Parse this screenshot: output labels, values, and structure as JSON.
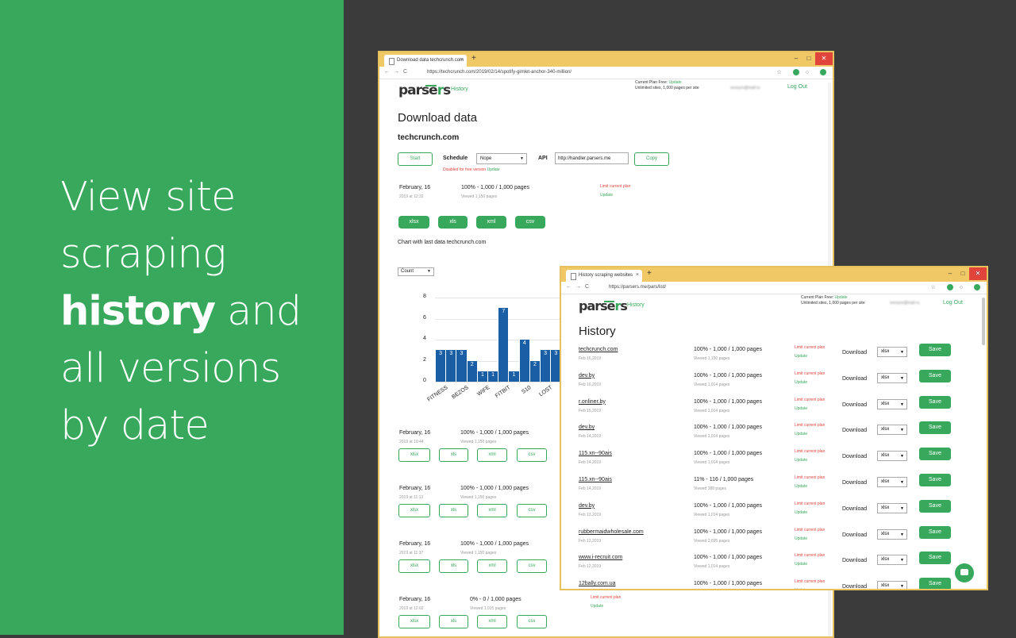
{
  "promo": {
    "line1": "View site",
    "line2": "scraping",
    "line3_bold": "history",
    "line3_rest": " and",
    "line4": "all versions",
    "line5": "by date"
  },
  "win1": {
    "tab_title": "Download data techcrunch.com",
    "url": "https://techcrunch.com/2019/02/14/spotify-gimlet-anchor-340-million/",
    "nav_history": "History",
    "plan_line1": "Current Plan Free: ",
    "plan_update": "Update",
    "plan_line2": "Unlimited sites, 1,000 pages per site",
    "email": "xxxxyzx@mail.ru",
    "logout": "Log Out",
    "title": "Download data",
    "site": "techcrunch.com",
    "start_label": "Start",
    "schedule_label": "Schedule",
    "schedule_value": "Nope",
    "disabled_note": "Disabled for free version",
    "disabled_update": "Update",
    "api_label": "API",
    "api_value": "http://handler.parsers.me",
    "copy_label": "Copy",
    "limit_text": "Limit current plan",
    "update_text": "Update",
    "chart_caption": "Chart with last data techcrunch.com",
    "count_select": "Count",
    "runs": [
      {
        "date": "February, 16",
        "time": "2019 at 12:32",
        "pages": "100% - 1,000 / 1,000 pages",
        "viewed": "Viewed 1,150 pages"
      },
      {
        "date": "February, 16",
        "time": "2019 at 10:44",
        "pages": "100% - 1,000 / 1,000 pages",
        "viewed": "Viewed 1,150 pages"
      },
      {
        "date": "February, 16",
        "time": "2019 at 11:13",
        "pages": "100% - 1,000 / 1,000 pages",
        "viewed": "Viewed 1,150 pages"
      },
      {
        "date": "February, 16",
        "time": "2019 at 11:37",
        "pages": "100% - 1,000 / 1,000 pages",
        "viewed": "Viewed 1,150 pages"
      },
      {
        "date": "February, 16",
        "time": "2019 at 12:02",
        "pages": "0% - 0 / 1,000 pages",
        "viewed": "Viewed 1,015 pages"
      }
    ],
    "formats": [
      "xlsx",
      "xls",
      "xml",
      "csv"
    ]
  },
  "chart_data": {
    "type": "bar",
    "categories": [
      "FITNESS",
      "",
      "BEZOS",
      "",
      "WIFE",
      "",
      "FITBIT",
      "",
      "S10",
      "",
      "LOST",
      ""
    ],
    "values": [
      3,
      3,
      3,
      2,
      1,
      1,
      7,
      1,
      4,
      2,
      3,
      3
    ],
    "ylim": [
      0,
      8
    ],
    "yticks": [
      0,
      2,
      4,
      6,
      8
    ],
    "grid": true
  },
  "win2": {
    "tab_title": "History scraping websites",
    "url": "https://parsers.me/pars/list/",
    "nav_history": "History",
    "plan_line1": "Current Plan Free: ",
    "plan_update": "Update",
    "plan_line2": "Unlimited sites, 1,000 pages per site",
    "email": "xxxxyzx@mail.ru",
    "logout": "Log Out",
    "title": "History",
    "limit_text": "Limit current plan",
    "update_text": "Update",
    "download_label": "Download",
    "format_value": "xlsx",
    "save_label": "Save",
    "rows": [
      {
        "site": "techcrunch.com",
        "date": "Feb 16,2019",
        "pages": "100% - 1,000 / 1,000 pages",
        "viewed": "Viewed 1,150 pages"
      },
      {
        "site": "dev.by",
        "date": "Feb 16,2019",
        "pages": "100% - 1,000 / 1,000 pages",
        "viewed": "Viewed 1,014 pages"
      },
      {
        "site": "r.onliner.by",
        "date": "Feb 15,2019",
        "pages": "100% - 1,000 / 1,000 pages",
        "viewed": "Viewed 1,014 pages"
      },
      {
        "site": "dev.by",
        "date": "Feb 14,2019",
        "pages": "100% - 1,000 / 1,000 pages",
        "viewed": "Viewed 1,014 pages"
      },
      {
        "site": "115.xn--90ais",
        "date": "Feb 14,2019",
        "pages": "100% - 1,000 / 1,000 pages",
        "viewed": "Viewed 1,014 pages"
      },
      {
        "site": "115.xn--90ais",
        "date": "Feb 14,2019",
        "pages": "11% - 116 / 1,000 pages",
        "viewed": "Viewed 388 pages"
      },
      {
        "site": "dev.by",
        "date": "Feb 13,2019",
        "pages": "100% - 1,000 / 1,000 pages",
        "viewed": "Viewed 1,014 pages"
      },
      {
        "site": "rubbermaidwholesale.com",
        "date": "Feb 13,2019",
        "pages": "100% - 1,000 / 1,000 pages",
        "viewed": "Viewed 2,695 pages"
      },
      {
        "site": "www.i-recruit.com",
        "date": "Feb 12,2019",
        "pages": "100% - 1,000 / 1,000 pages",
        "viewed": "Viewed 1,014 pages"
      },
      {
        "site": "12bally.com.ua",
        "date": "",
        "pages": "100% - 1,000 / 1,000 pages",
        "viewed": ""
      }
    ]
  }
}
